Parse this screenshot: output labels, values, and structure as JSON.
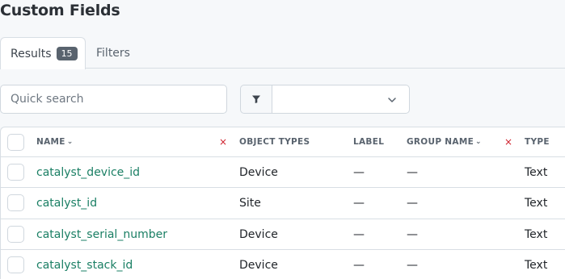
{
  "page": {
    "title": "Custom Fields"
  },
  "tabs": [
    {
      "label": "Results",
      "count": "15"
    },
    {
      "label": "Filters"
    }
  ],
  "search": {
    "placeholder": "Quick search"
  },
  "filter": {
    "selected": ""
  },
  "table": {
    "headers": {
      "name": "NAME",
      "object_types": "OBJECT TYPES",
      "label": "LABEL",
      "group_name": "GROUP NAME",
      "type": "TYPE"
    },
    "sort_glyph": "⌄",
    "clear_glyph": "×",
    "rows": [
      {
        "name": "catalyst_device_id",
        "object_types": "Device",
        "label": "—",
        "group_name": "—",
        "type": "Text"
      },
      {
        "name": "catalyst_id",
        "object_types": "Site",
        "label": "—",
        "group_name": "—",
        "type": "Text"
      },
      {
        "name": "catalyst_serial_number",
        "object_types": "Device",
        "label": "—",
        "group_name": "—",
        "type": "Text"
      },
      {
        "name": "catalyst_stack_id",
        "object_types": "Device",
        "label": "—",
        "group_name": "—",
        "type": "Text"
      }
    ]
  }
}
